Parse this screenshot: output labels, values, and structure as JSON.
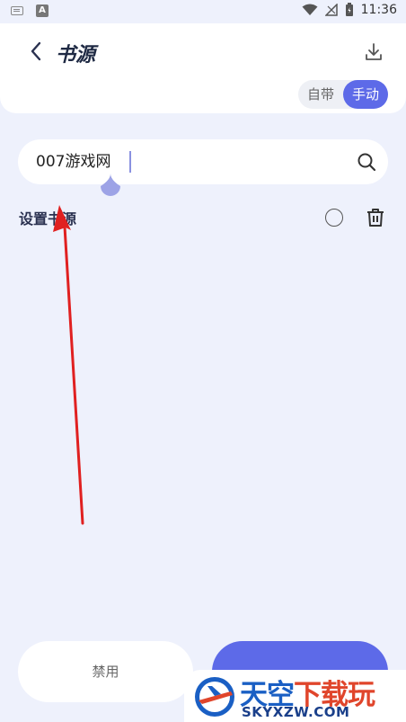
{
  "status_bar": {
    "time": "11:36",
    "left_a_glyph": "A"
  },
  "header": {
    "title": "书源",
    "back_icon": "chevron-left-icon",
    "download_icon": "download-icon",
    "segments": [
      "自带",
      "手动"
    ],
    "active_segment": "手动"
  },
  "search": {
    "value": "007游戏网",
    "icon": "search-icon"
  },
  "source_row": {
    "label": "设置书源",
    "radio_icon": "radio-unchecked-icon",
    "delete_icon": "trash-icon"
  },
  "footer": {
    "disable_label": "禁用"
  },
  "watermark": {
    "title_main": "天空",
    "title_accent": "下载玩",
    "url": "SKYXZW.COM"
  },
  "colors": {
    "accent": "#5d6ae8",
    "background": "#eef1fc",
    "arrow": "#e02020"
  }
}
